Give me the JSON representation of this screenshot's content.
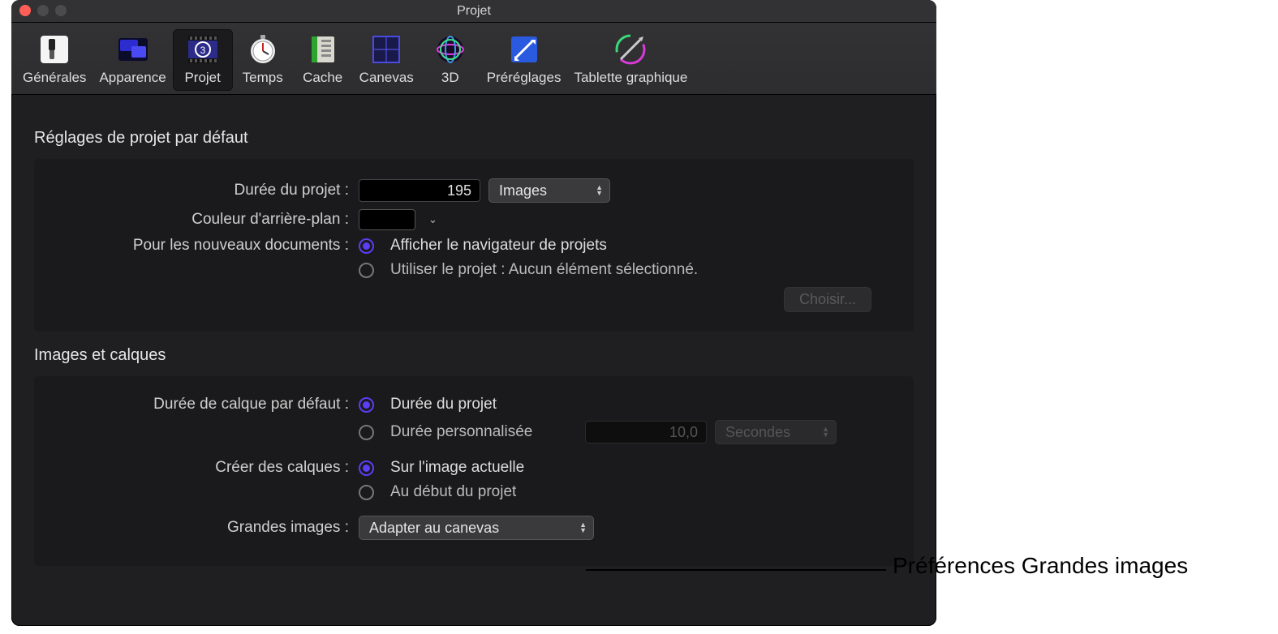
{
  "window": {
    "title": "Projet"
  },
  "toolbar": {
    "items": [
      {
        "label": "Générales"
      },
      {
        "label": "Apparence"
      },
      {
        "label": "Projet"
      },
      {
        "label": "Temps"
      },
      {
        "label": "Cache"
      },
      {
        "label": "Canevas"
      },
      {
        "label": "3D"
      },
      {
        "label": "Préréglages"
      },
      {
        "label": "Tablette graphique"
      }
    ],
    "active_index": 2
  },
  "section1": {
    "title": "Réglages de projet par défaut",
    "duration_label": "Durée du projet :",
    "duration_value": "195",
    "duration_unit": "Images",
    "bgcolor_label": "Couleur d'arrière-plan :",
    "bgcolor_value": "#000000",
    "newdoc_label": "Pour les nouveaux documents :",
    "newdoc_option1": "Afficher le navigateur de projets",
    "newdoc_option2_prefix": "Utiliser le projet : ",
    "newdoc_option2_value": "Aucun élément sélectionné.",
    "newdoc_selected": 0,
    "choose_button": "Choisir..."
  },
  "section2": {
    "title": "Images et calques",
    "layerdur_label": "Durée de calque par défaut :",
    "layerdur_option1": "Durée du projet",
    "layerdur_option2": "Durée personnalisée",
    "layerdur_selected": 0,
    "custom_value": "10,0",
    "custom_unit": "Secondes",
    "create_label": "Créer des calques :",
    "create_option1": "Sur l'image actuelle",
    "create_option2": "Au début du projet",
    "create_selected": 0,
    "large_label": "Grandes images :",
    "large_value": "Adapter au canevas"
  },
  "callout": "Préférences Grandes images"
}
